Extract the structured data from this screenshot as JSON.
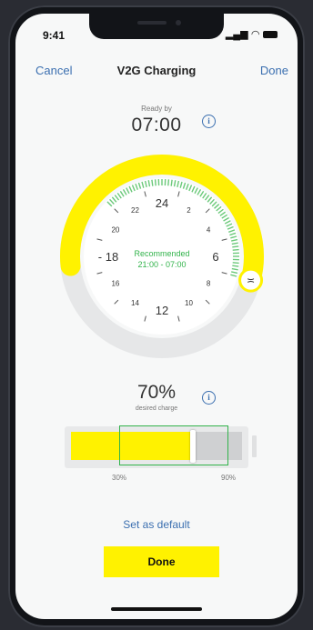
{
  "status_bar": {
    "time": "9:41"
  },
  "nav": {
    "cancel": "Cancel",
    "title": "V2G Charging",
    "done": "Done"
  },
  "ready": {
    "label": "Ready by",
    "time": "07:00"
  },
  "dial": {
    "recommended_label": "Recommended",
    "recommended_range": "21:00 - 07:00",
    "hour_labels": [
      {
        "text": "24",
        "hour": 24
      },
      {
        "text": "2",
        "hour": 2
      },
      {
        "text": "4",
        "hour": 4
      },
      {
        "text": "6",
        "hour": 6
      },
      {
        "text": "8",
        "hour": 8
      },
      {
        "text": "10",
        "hour": 10
      },
      {
        "text": "12",
        "hour": 12
      },
      {
        "text": "14",
        "hour": 14
      },
      {
        "text": "16",
        "hour": 16
      },
      {
        "text": "- 18",
        "hour": 18
      },
      {
        "text": "20",
        "hour": 20
      },
      {
        "text": "22",
        "hour": 22
      }
    ],
    "plug_in_hour": 17.6,
    "ready_hour": 7,
    "recommended_start_hour": 21,
    "recommended_end_hour": 7,
    "colors": {
      "active": "#fff200",
      "track": "#e6e7e8",
      "recommended": "#6bc97a",
      "text_green": "#32b34b"
    }
  },
  "charge": {
    "percent": "70%",
    "label": "desired charge",
    "value": 0.7,
    "min_label": "30%",
    "max_label": "90%"
  },
  "footer": {
    "set_default": "Set as default",
    "done": "Done"
  },
  "icons": {
    "info": "info-icon",
    "plug": "plug-icon"
  }
}
